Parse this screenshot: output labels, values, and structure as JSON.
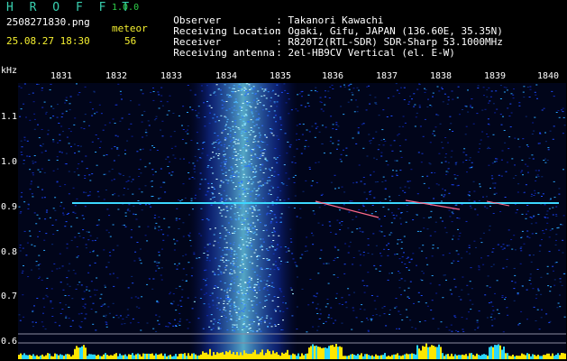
{
  "app": {
    "title": "H R O F F T",
    "version": "1.0.0",
    "filename": "2508271830.png",
    "datetime": "25.08.27 18:30",
    "mode": "meteor",
    "count": "56"
  },
  "station": [
    {
      "key": "Observer",
      "value": "Takanori Kawachi"
    },
    {
      "key": "Receiving Location",
      "value": "Ogaki, Gifu, JAPAN (136.60E, 35.35N)"
    },
    {
      "key": "Receiver",
      "value": "R820T2(RTL-SDR) SDR-Sharp 53.1000MHz"
    },
    {
      "key": "Receiving antenna",
      "value": "2el-HB9CV Vertical (el. E-W)"
    }
  ],
  "axis": {
    "y_unit": "kHz",
    "x_ticks": [
      "1831",
      "1832",
      "1833",
      "1834",
      "1835",
      "1836",
      "1837",
      "1838",
      "1839",
      "1840"
    ],
    "y_ticks": [
      "1.1",
      "1.0",
      "0.9",
      "0.8",
      "0.7",
      "0.6"
    ]
  },
  "colors": {
    "background": "#000000",
    "noise_blue": "#1e3cff",
    "noise_cyan": "#2ad6ff",
    "carrier": "#3cd8ff",
    "echo": "#ff6a8a",
    "baseline_yellow": "#ffe600",
    "header_yellow": "#f5f030",
    "header_green": "#2fd24a"
  }
}
